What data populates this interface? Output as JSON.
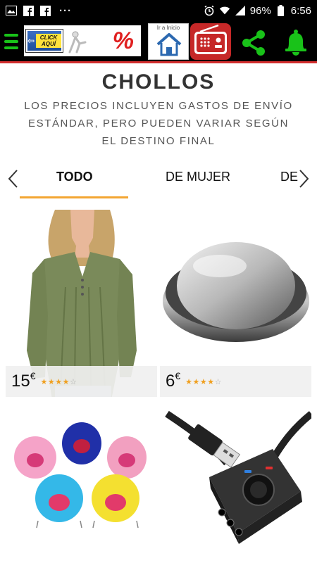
{
  "status_bar": {
    "battery": "96%",
    "time": "6:56",
    "dots": "···"
  },
  "app_bar": {
    "banner_label": "CLICK AQUÍ",
    "banner_percent": "%",
    "home_label": "Ir a Inicio",
    "colors": {
      "menu": "#19c219",
      "share": "#19c219",
      "bell": "#19c219",
      "radio": "#c62828",
      "accent": "#d32f2f"
    }
  },
  "page": {
    "title": "CHOLLOS",
    "subtitle": "LOS PRECIOS INCLUYEN GASTOS DE ENVÍO ESTÁNDAR, PERO PUEDEN VARIAR SEGÚN EL DESTINO FINAL"
  },
  "tabs": {
    "items": [
      "TODO",
      "DE MUJER",
      "DE"
    ],
    "active": "TODO",
    "underline_color": "#f3a633"
  },
  "products": [
    {
      "price": "15",
      "currency": "€",
      "rating": 4,
      "image": "green-blouse"
    },
    {
      "price": "6",
      "currency": "€",
      "rating": 4,
      "image": "steel-soap"
    },
    {
      "image": "pet-hammocks"
    },
    {
      "image": "usb-sound-card"
    }
  ]
}
